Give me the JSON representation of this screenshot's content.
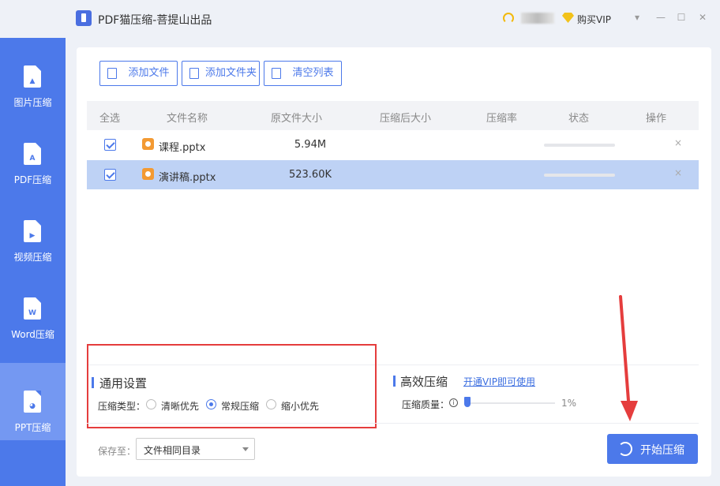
{
  "window": {
    "title": "PDF猫压缩-菩提山出品",
    "user_name": "",
    "vip_label": "购买VIP",
    "controls": [
      "▾",
      "—",
      "☐",
      "✕"
    ]
  },
  "sidebar": {
    "items": [
      {
        "label": "图片压缩",
        "icon": "image-file-icon",
        "glyph": "▲",
        "active": false
      },
      {
        "label": "PDF压缩",
        "icon": "pdf-file-icon",
        "glyph": "A",
        "active": false
      },
      {
        "label": "视频压缩",
        "icon": "video-file-icon",
        "glyph": "▶",
        "active": false
      },
      {
        "label": "Word压缩",
        "icon": "word-file-icon",
        "glyph": "W",
        "active": false
      },
      {
        "label": "PPT压缩",
        "icon": "ppt-file-icon",
        "glyph": "◕",
        "active": true
      }
    ]
  },
  "toolbar": {
    "add_file": "添加文件",
    "add_folder": "添加文件夹",
    "clear_list": "清空列表"
  },
  "table": {
    "headers": [
      "全选",
      "文件名称",
      "原文件大小",
      "压缩后大小",
      "压缩率",
      "状态",
      "操作"
    ],
    "rows": [
      {
        "checked": true,
        "name": "课程.pptx",
        "size": "5.94M",
        "compressed": "",
        "ratio": "",
        "progress": 0,
        "selected": false
      },
      {
        "checked": true,
        "name": "演讲稿.pptx",
        "size": "523.60K",
        "compressed": "",
        "ratio": "",
        "progress": 0,
        "selected": true
      }
    ],
    "delete_glyph": "×"
  },
  "general_settings": {
    "title": "通用设置",
    "type_label": "压缩类型：",
    "options": [
      {
        "label": "清晰优先",
        "selected": false
      },
      {
        "label": "常规压缩",
        "selected": true
      },
      {
        "label": "缩小优先",
        "selected": false
      }
    ]
  },
  "efficient": {
    "title": "高效压缩",
    "vip_link": "开通VIP即可使用",
    "quality_label": "压缩质量：",
    "info_glyph": "i",
    "quality_value": "1%",
    "quality_fraction": 0.01
  },
  "output": {
    "save_label": "保存至：",
    "save_value": "文件相同目录"
  },
  "start_button": "开始压缩",
  "colors": {
    "accent": "#4c79ea",
    "sidebar": "#4c79ea",
    "sidebar_active": "#7498f2",
    "row_selected": "#bed2f5",
    "annotation_red": "#e53d3d"
  }
}
